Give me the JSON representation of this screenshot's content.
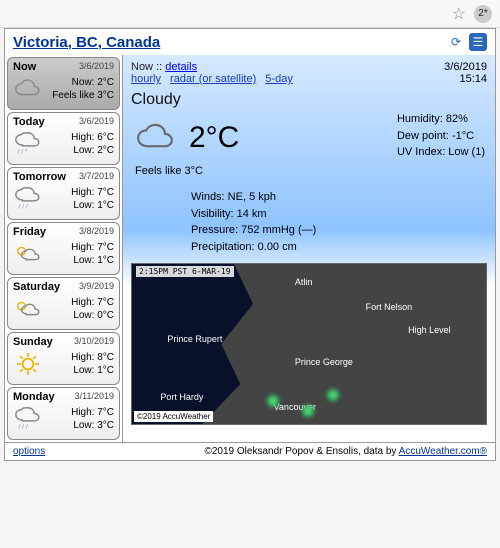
{
  "chrome": {
    "badge": "2*"
  },
  "header": {
    "location": "Victoria, BC, Canada"
  },
  "now_card": {
    "label": "Now",
    "date": "3/6/2019",
    "line1": "Now: 2°C",
    "line2": "Feels like 3°C"
  },
  "forecast": [
    {
      "day": "Today",
      "date": "3/6/2019",
      "high": "High: 6°C",
      "low": "Low: 2°C",
      "icon": "cloud-snow"
    },
    {
      "day": "Tomorrow",
      "date": "3/7/2019",
      "high": "High: 7°C",
      "low": "Low: 1°C",
      "icon": "rain"
    },
    {
      "day": "Friday",
      "date": "3/8/2019",
      "high": "High: 7°C",
      "low": "Low: 1°C",
      "icon": "partly"
    },
    {
      "day": "Saturday",
      "date": "3/9/2019",
      "high": "High: 7°C",
      "low": "Low: 0°C",
      "icon": "partly"
    },
    {
      "day": "Sunday",
      "date": "3/10/2019",
      "high": "High: 8°C",
      "low": "Low: 1°C",
      "icon": "sunny"
    },
    {
      "day": "Monday",
      "date": "3/11/2019",
      "high": "High: 7°C",
      "low": "Low: 3°C",
      "icon": "rain"
    }
  ],
  "main": {
    "now_label": "Now",
    "sep": "::",
    "link_details": "details",
    "link_hourly": "hourly",
    "link_radar": "radar (or satellite)",
    "link_5day": "5-day",
    "date": "3/6/2019",
    "time": "15:14",
    "condition": "Cloudy",
    "temp": "2°C",
    "feels": "Feels like 3°C",
    "humidity": "Humidity: 82%",
    "dewpoint": "Dew point: -1°C",
    "uv": "UV Index: Low (1)",
    "winds": "Winds: NE, 5 kph",
    "visibility": "Visibility: 14 km",
    "pressure": "Pressure: 752 mmHg (—)",
    "precip": "Precipitation: 0.00 cm"
  },
  "radar": {
    "timestamp": "2:15PM PST 6-MAR-19",
    "attrib": "©2019 AccuWeather",
    "places": [
      "Atlin",
      "Fort Nelson",
      "Prince Rupert",
      "High Level",
      "Prince George",
      "Port Hardy",
      "Vancouver"
    ]
  },
  "footer": {
    "options": "options",
    "credit_pre": "©2019 Oleksandr Popov & Ensolis, data by ",
    "credit_link": "AccuWeather.com®"
  }
}
